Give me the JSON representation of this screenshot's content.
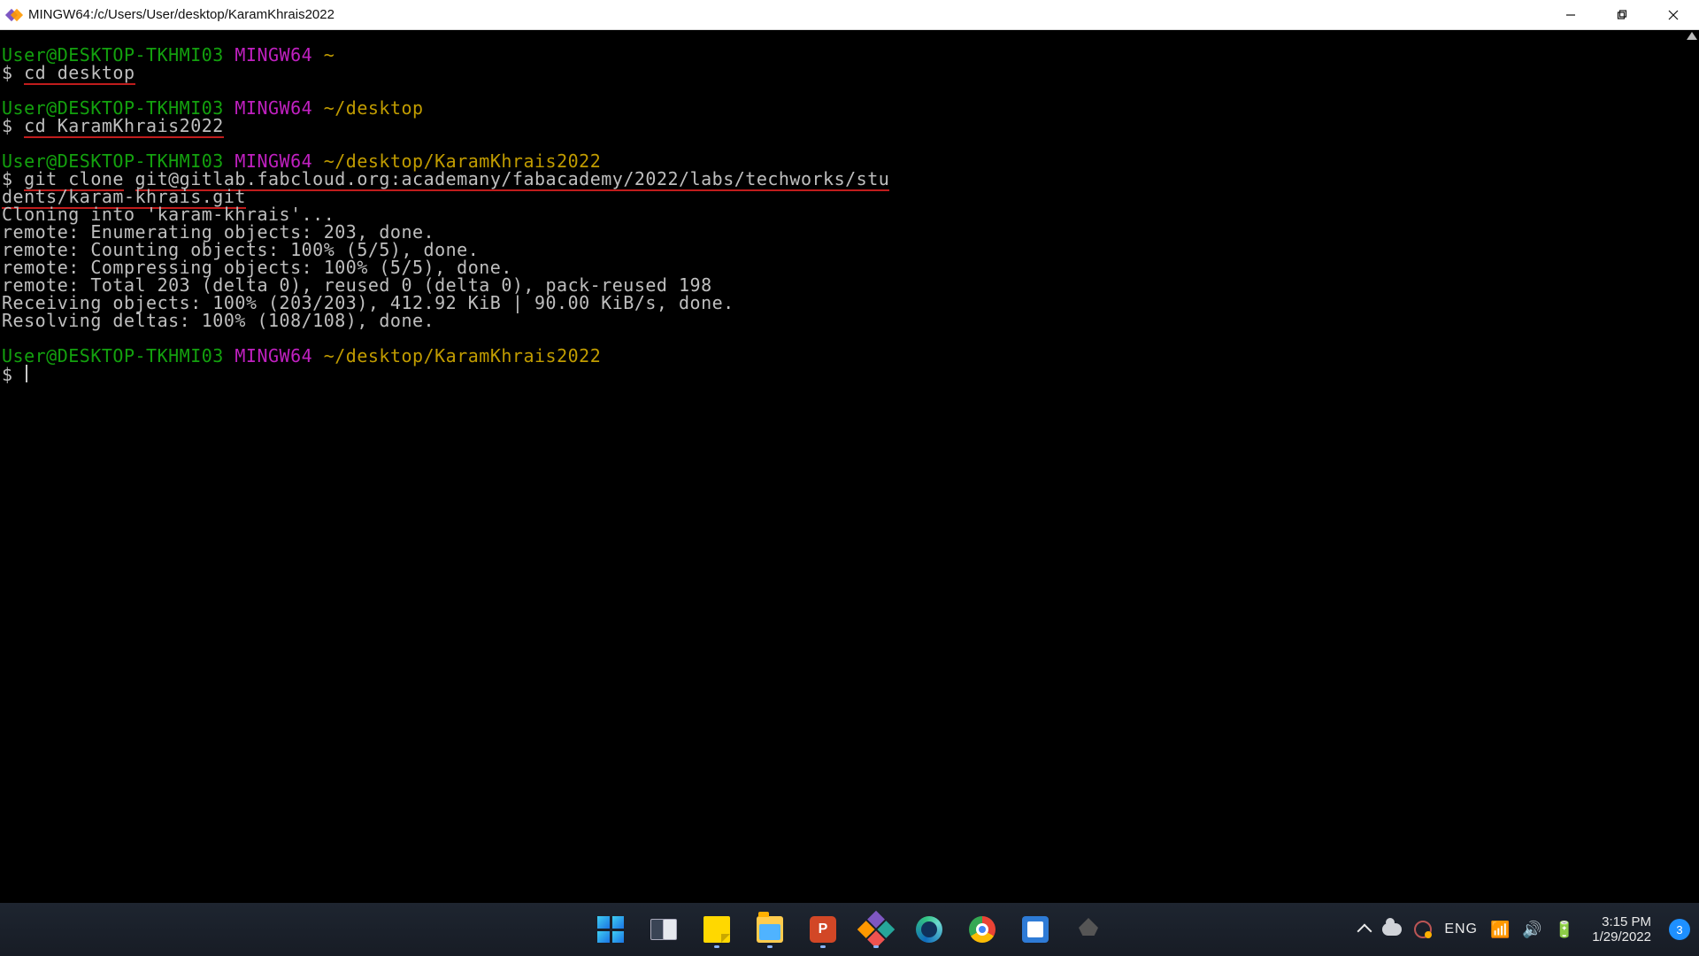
{
  "titlebar": {
    "title": "MINGW64:/c/Users/User/desktop/KaramKhrais2022"
  },
  "prompt": {
    "userhost": "User@DESKTOP-TKHMI03",
    "shell": "MINGW64",
    "path_home": "~",
    "path_desktop": "~/desktop",
    "path_project": "~/desktop/KaramKhrais2022",
    "ps1": "$ "
  },
  "cmds": {
    "cd_desktop": "cd desktop",
    "cd_project": "cd KaramKhrais2022",
    "git_clone_a": "git clone",
    "git_clone_url_a": "git@gitlab.fabcloud.org:academany/fabacademy/2022/labs/techworks/stu",
    "git_clone_url_b": "dents/karam-khrais.git"
  },
  "out": {
    "l1": "Cloning into 'karam-khrais'...",
    "l2": "remote: Enumerating objects: 203, done.",
    "l3": "remote: Counting objects: 100% (5/5), done.",
    "l4": "remote: Compressing objects: 100% (5/5), done.",
    "l5": "remote: Total 203 (delta 0), reused 0 (delta 0), pack-reused 198",
    "l6": "Receiving objects: 100% (203/203), 412.92 KiB | 90.00 KiB/s, done.",
    "l7": "Resolving deltas: 100% (108/108), done."
  },
  "taskbar": {
    "lang": "ENG",
    "time": "3:15 PM",
    "date": "1/29/2022",
    "notif_count": "3",
    "ppt_letter": "P"
  }
}
